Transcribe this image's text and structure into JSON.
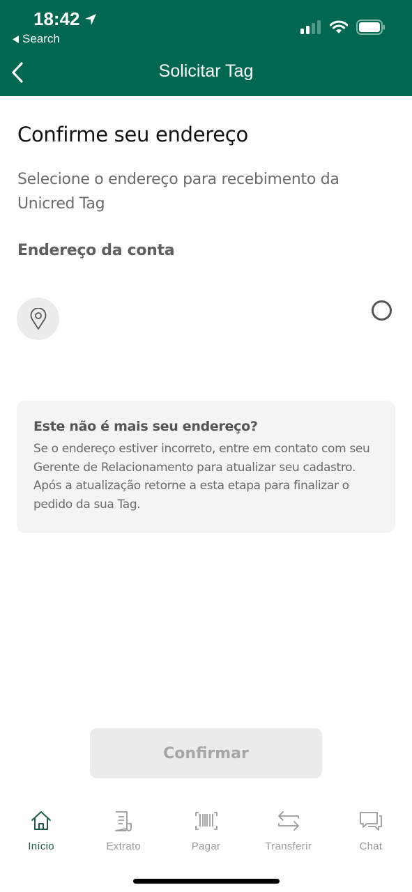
{
  "status_bar": {
    "time": "18:42",
    "back_app": "Search"
  },
  "nav": {
    "title": "Solicitar Tag"
  },
  "content": {
    "title": "Confirme seu endereço",
    "subtitle": "Selecione o endereço para recebimento da Unicred Tag",
    "section_label": "Endereço da conta",
    "address": {
      "text": "",
      "selected": false
    },
    "info_card": {
      "title": "Este não é mais seu endereço?",
      "body": "Se o endereço estiver incorreto, entre em contato com seu Gerente de Relacionamento para atualizar seu cadastro. Após a atualização retorne a esta etapa para finalizar o pedido da sua Tag."
    },
    "confirm_button": {
      "label": "Confirmar",
      "enabled": false
    }
  },
  "tabbar": {
    "items": [
      {
        "label": "Início",
        "icon": "home-icon",
        "active": true
      },
      {
        "label": "Extrato",
        "icon": "statement-icon",
        "active": false
      },
      {
        "label": "Pagar",
        "icon": "barcode-icon",
        "active": false
      },
      {
        "label": "Transferir",
        "icon": "transfer-icon",
        "active": false
      },
      {
        "label": "Chat",
        "icon": "chat-icon",
        "active": false
      }
    ]
  },
  "colors": {
    "brand": "#006851",
    "active_tab": "#1d5a4b",
    "inactive_tab": "#9a9a9a"
  }
}
